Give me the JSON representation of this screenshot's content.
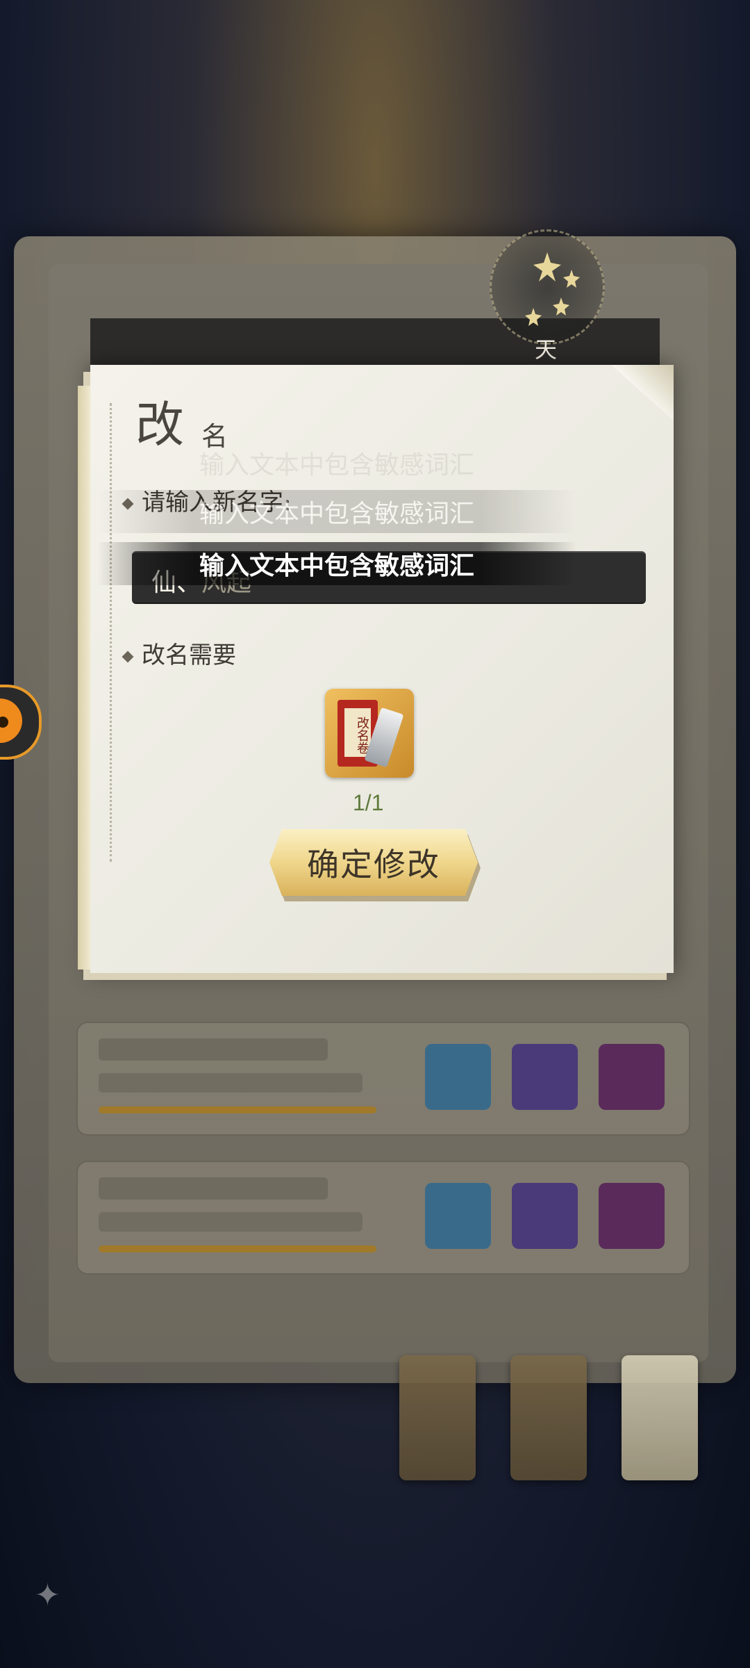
{
  "emblem": {
    "label": "天"
  },
  "dialog": {
    "title_main": "改",
    "title_sub": "名",
    "name_prompt": "请输入新名字:",
    "name_value": "仙、",
    "name_value_ghost": "风起",
    "requirement_label": "改名需要",
    "item": {
      "name": "改名卷",
      "count": "1/1"
    },
    "confirm_label": "确定修改"
  },
  "toasts": [
    {
      "text": "输入文本中包含敏感词汇",
      "state": "ghost"
    },
    {
      "text": "输入文本中包含敏感词汇",
      "state": "faded"
    },
    {
      "text": "输入文本中包含敏感词汇",
      "state": "active"
    }
  ],
  "colors": {
    "dialog_bg": "#f0efe6",
    "input_bg": "#2e2e2e",
    "button_gold": "#efd68b",
    "count_green": "#5f7a3c"
  }
}
